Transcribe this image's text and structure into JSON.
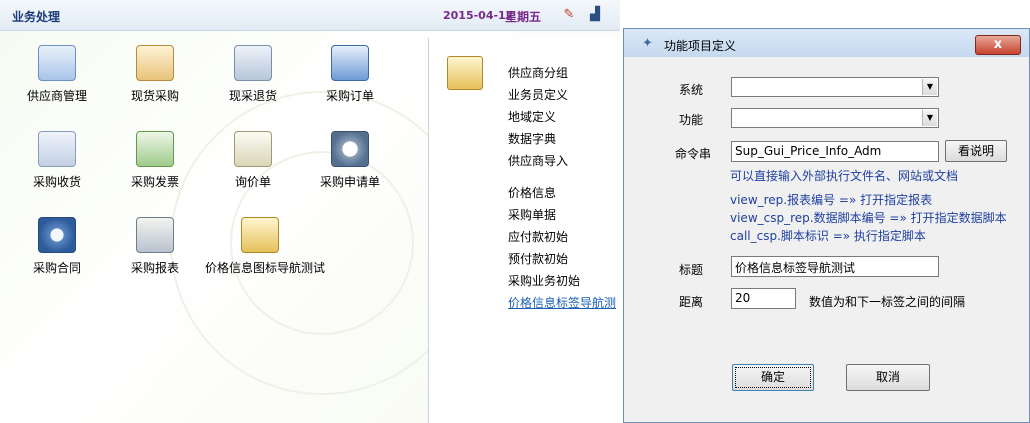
{
  "app": {
    "title": "业务处理",
    "date": "2015-04-17",
    "weekday": "星期五",
    "tiles": [
      {
        "label": "供应商管理",
        "icon": "supplier-management-icon"
      },
      {
        "label": "现货采购",
        "icon": "spot-purchase-icon"
      },
      {
        "label": "现采退货",
        "icon": "purchase-return-icon"
      },
      {
        "label": "采购订单",
        "icon": "purchase-order-icon"
      },
      {
        "label": "采购收货",
        "icon": "purchase-receipt-icon"
      },
      {
        "label": "采购发票",
        "icon": "purchase-invoice-icon"
      },
      {
        "label": "询价单",
        "icon": "inquiry-icon"
      },
      {
        "label": "采购申请单",
        "icon": "purchase-request-icon"
      },
      {
        "label": "采购合同",
        "icon": "purchase-contract-icon"
      },
      {
        "label": "采购报表",
        "icon": "purchase-report-icon"
      },
      {
        "label": "价格信息图标导航测试",
        "icon": "price-info-nav-icon"
      }
    ],
    "nav": {
      "group1": [
        "供应商分组",
        "业务员定义",
        "地域定义",
        "数据字典",
        "供应商导入"
      ],
      "group2": [
        "价格信息",
        "采购单据",
        "应付款初始",
        "预付款初始",
        "采购业务初始",
        "价格信息标签导航测"
      ]
    }
  },
  "dialog": {
    "title": "功能项目定义",
    "close": "x",
    "labels": {
      "system": "系统",
      "function": "功能",
      "command": "命令串",
      "caption": "标题",
      "distance": "距离"
    },
    "fields": {
      "system_value": "",
      "function_value": "",
      "command_value": "Sup_Gui_Price_Info_Adm",
      "caption_value": "价格信息标签导航测试",
      "distance_value": "20"
    },
    "view_help_button": "看说明",
    "hints": [
      "可以直接输入外部执行文件名、网站或文档",
      "view_rep.报表编号  =» 打开指定报表",
      "view_csp_rep.数据脚本编号  =» 打开指定数据脚本",
      "call_csp.脚本标识  =» 执行指定脚本"
    ],
    "distance_hint": "数值为和下一标签之间的间隔",
    "ok_button": "确定",
    "cancel_button": "取消"
  }
}
